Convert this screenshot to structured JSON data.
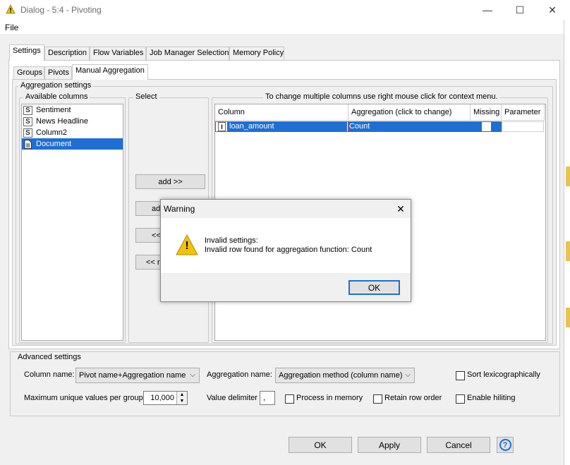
{
  "window": {
    "title": "Dialog - 5:4 - Pivoting",
    "minimize_glyph": "—",
    "maximize_glyph": "☐",
    "close_glyph": "✕",
    "app_icon": "warning-triangle-icon"
  },
  "menu": {
    "file": "File"
  },
  "tabs": [
    {
      "label": "Settings",
      "active": true
    },
    {
      "label": "Description"
    },
    {
      "label": "Flow Variables"
    },
    {
      "label": "Job Manager Selection"
    },
    {
      "label": "Memory Policy"
    }
  ],
  "subtabs": [
    {
      "label": "Groups"
    },
    {
      "label": "Pivots"
    },
    {
      "label": "Manual Aggregation",
      "active": true
    }
  ],
  "aggregation": {
    "title": "Aggregation settings",
    "available_title": "Available columns",
    "columns": [
      {
        "type": "S",
        "name": "Sentiment"
      },
      {
        "type": "S",
        "name": "News Headline"
      },
      {
        "type": "S",
        "name": "Column2"
      },
      {
        "type": "doc",
        "name": "Document",
        "selected": true
      }
    ],
    "select_title": "Select",
    "buttons": {
      "add": "add >>",
      "add_all_partial": "ad",
      "remove_partial": "<<",
      "remove_all_partial": "<< r"
    },
    "table_hint": "To change multiple columns use right mouse click for context menu.",
    "headers": {
      "column": "Column",
      "aggregation": "Aggregation (click to change)",
      "missing": "Missing",
      "parameter": "Parameter"
    },
    "row": {
      "type": "I",
      "column": "loan_amount",
      "aggregation": "Count",
      "missing": false
    }
  },
  "advanced": {
    "title": "Advanced settings",
    "column_name_label": "Column name:",
    "column_name_value": "Pivot name+Aggregation name",
    "aggregation_name_label": "Aggregation name:",
    "aggregation_name_value": "Aggregation method (column name)",
    "sort_label": "Sort lexicographically",
    "max_unique_label": "Maximum unique values per group",
    "max_unique_value": "10,000",
    "value_delimiter_label": "Value delimiter",
    "value_delimiter_value": ",",
    "process_in_memory_label": "Process in memory",
    "retain_row_order_label": "Retain row order",
    "enable_hiliting_label": "Enable hiliting"
  },
  "footer": {
    "ok": "OK",
    "apply": "Apply",
    "cancel": "Cancel",
    "help_glyph": "?"
  },
  "warning": {
    "title": "Warning",
    "line1": "Invalid settings:",
    "line2": "Invalid row found for aggregation function: Count",
    "ok": "OK",
    "icon_glyph": "!"
  },
  "colors": {
    "selection": "#1e6fd4",
    "warning_yellow": "#f4c20d",
    "error_border": "#e0393e"
  }
}
